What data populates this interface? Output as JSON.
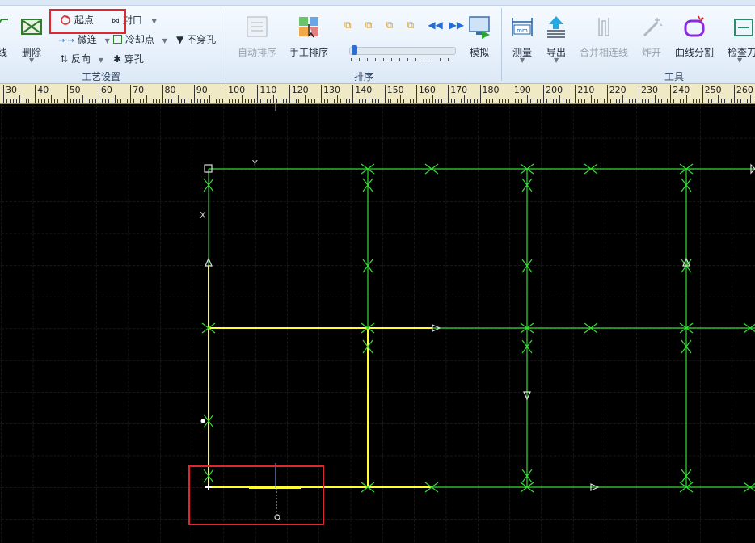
{
  "ribbon": {
    "process_group": {
      "title": "工艺设置",
      "cut_line_partial": "线",
      "delete": "删除",
      "start_point": "起点",
      "seal": "封口",
      "micro_joint": "微连",
      "cooling_point": "冷却点",
      "no_pierce": "不穿孔",
      "reverse": "反向",
      "pierce": "穿孔"
    },
    "sort_group": {
      "title": "排序",
      "auto_sort": "自动排序",
      "manual_sort": "手工排序",
      "simulate": "模拟",
      "speed_slider": 0.02
    },
    "tools_group": {
      "title": "工具",
      "measure": "测量",
      "export": "导出",
      "merge_lines": "合并相连线",
      "explode": "炸开",
      "curve_split": "曲线分割",
      "check_tool": "检查刀"
    }
  },
  "ruler": {
    "labels": [
      "30",
      "40",
      "50",
      "60",
      "70",
      "80",
      "90",
      "100",
      "110",
      "120",
      "130",
      "140",
      "150",
      "160",
      "170",
      "180",
      "190",
      "200",
      "210",
      "220",
      "230",
      "240",
      "250",
      "260"
    ]
  },
  "canvas": {
    "axis_y_label": "Y",
    "axis_x_label": "X",
    "colors": {
      "background": "#000000",
      "grid": "#2f2f2f",
      "path": "#33dd33",
      "selected": "#ffff33",
      "highlight": "#e0262e"
    }
  }
}
